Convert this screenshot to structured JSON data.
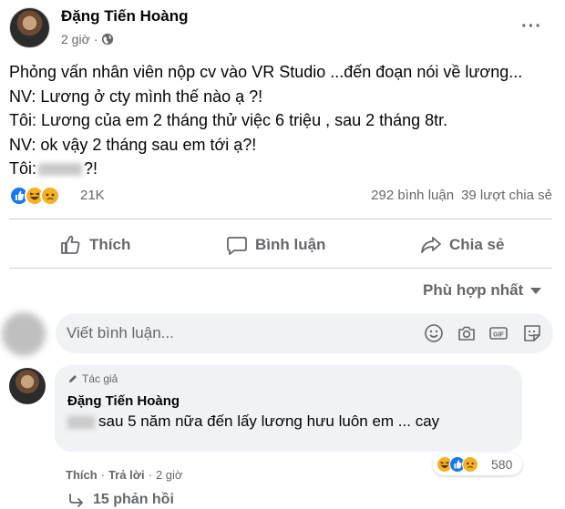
{
  "post": {
    "author": "Đặng Tiến Hoàng",
    "time": "2 giờ",
    "separator": "·",
    "more_label": "···",
    "lines": [
      "Phỏng vấn nhân viên nộp cv vào VR Studio ...đến đoạn nói về lương...",
      "NV: Lương ở cty mình thế nào ạ ?!",
      "Tôi: Lương của em 2 tháng thử việc 6 triệu , sau 2 tháng 8tr.",
      "NV: ok vậy 2 tháng sau em tới ạ?!",
      "Tôi:"
    ],
    "last_line_suffix": "?!"
  },
  "reactions": {
    "count": "21K",
    "comments": "292 bình luận",
    "shares": "39 lượt chia sẻ"
  },
  "actions": {
    "like": "Thích",
    "comment": "Bình luận",
    "share": "Chia sẻ"
  },
  "sort": {
    "label": "Phù hợp nhất"
  },
  "comment_input": {
    "placeholder": "Viết bình luận..."
  },
  "author_comment": {
    "tag": "Tác giả",
    "author": "Đặng Tiến Hoàng",
    "text": "sau 5 năm nữa đến lấy lương hưu luôn em ... cay",
    "reaction_count": "580",
    "like_label": "Thích",
    "reply_label": "Trả lời",
    "time": "2 giờ",
    "dot": "·"
  },
  "replies": {
    "label": "15 phản hồi"
  },
  "colors": {
    "accent": "#1877f2",
    "muted": "#65676b",
    "bubble": "#f0f2f5"
  }
}
